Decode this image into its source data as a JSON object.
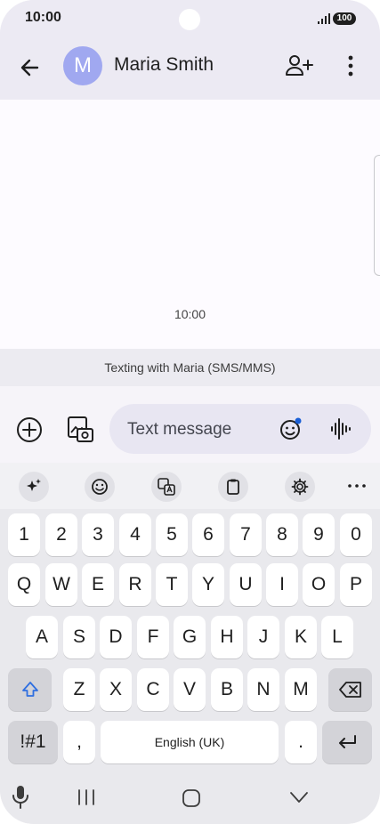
{
  "status_bar": {
    "time": "10:00",
    "battery": "100"
  },
  "header": {
    "avatar_letter": "M",
    "contact_name": "Maria Smith"
  },
  "conversation": {
    "timestamp": "10:00",
    "sms_info": "Texting with Maria (SMS/MMS)"
  },
  "compose": {
    "placeholder": "Text message"
  },
  "keyboard": {
    "numbers": [
      "1",
      "2",
      "3",
      "4",
      "5",
      "6",
      "7",
      "8",
      "9",
      "0"
    ],
    "row1": [
      "Q",
      "W",
      "E",
      "R",
      "T",
      "Y",
      "U",
      "I",
      "O",
      "P"
    ],
    "row2": [
      "A",
      "S",
      "D",
      "F",
      "G",
      "H",
      "J",
      "K",
      "L"
    ],
    "row3": [
      "Z",
      "X",
      "C",
      "V",
      "B",
      "N",
      "M"
    ],
    "symbols_label": "!#1",
    "comma": ",",
    "space_label": "English (UK)",
    "period": "."
  }
}
